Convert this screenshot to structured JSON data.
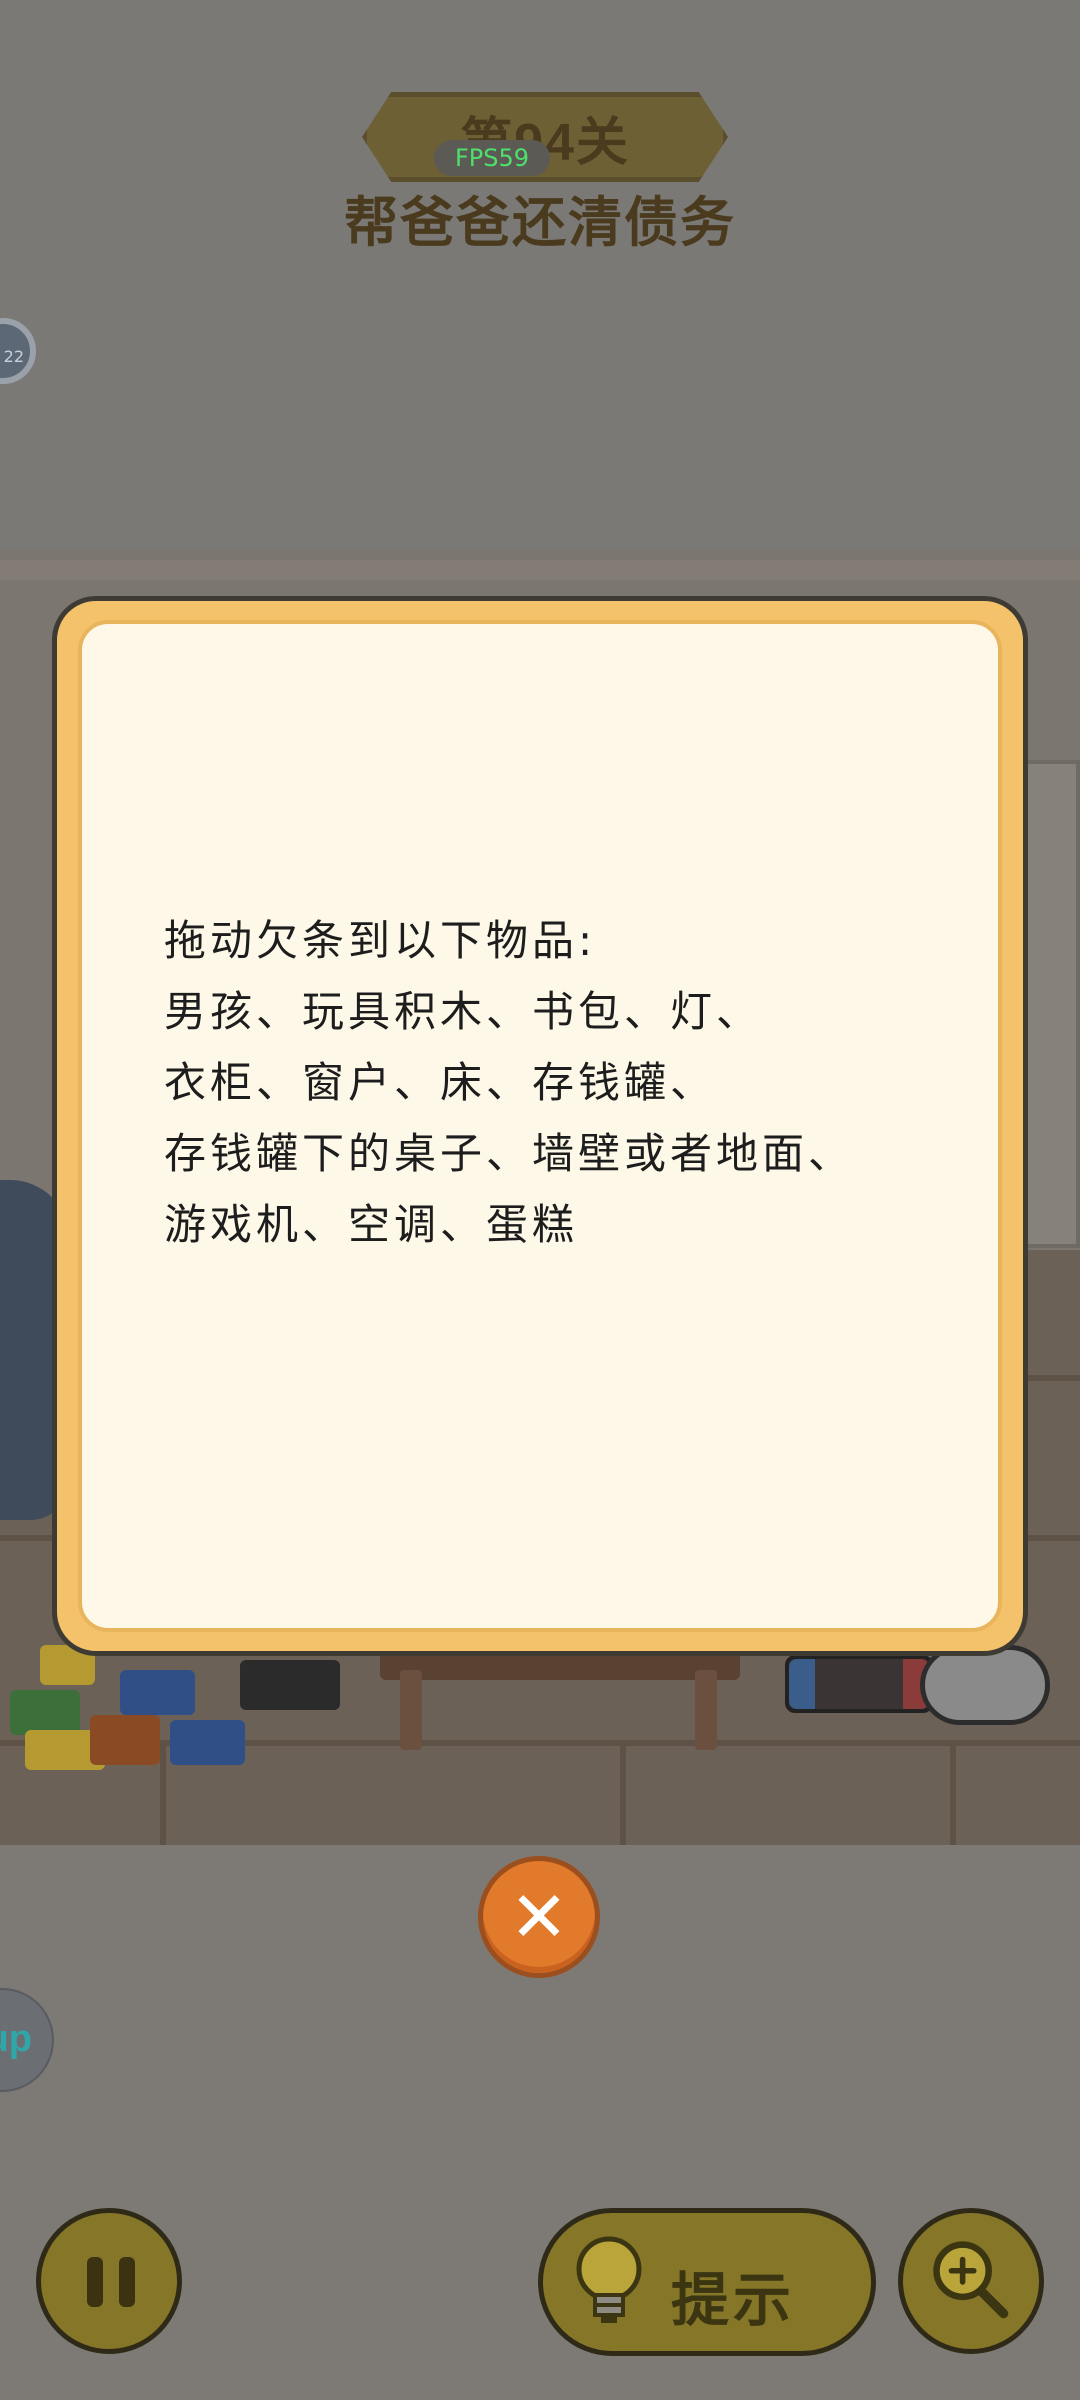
{
  "hud": {
    "level": "第94关",
    "fps": "FPS59",
    "subtitle": "帮爸爸还清债务",
    "side_badge": "22"
  },
  "dialog": {
    "lines": [
      "拖动欠条到以下物品:",
      "男孩、玩具积木、书包、灯、",
      "衣柜、窗户、床、存钱罐、",
      "存钱罐下的桌子、墙壁或者地面、",
      "游戏机、空调、蛋糕"
    ],
    "close_symbol": "✕"
  },
  "side": {
    "up_label": "up"
  },
  "buttons": {
    "hint_label": "提示",
    "pause_icon": "pause-icon",
    "zoom_icon": "zoom-in-icon",
    "hint_icon": "lightbulb-icon"
  },
  "colors": {
    "dialog_border": "#f3c26a",
    "dialog_bg": "#fdf8e8",
    "close_button": "#e27a2c",
    "button_fill": "#867628",
    "hud_text": "#4a3a1e",
    "fps_text": "#4ee06a"
  }
}
